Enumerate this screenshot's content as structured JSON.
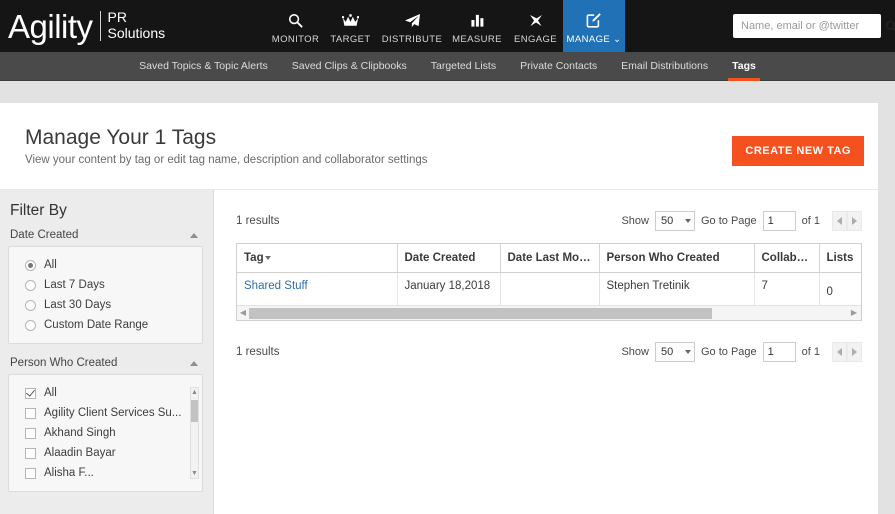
{
  "header": {
    "logo_main": "Agility",
    "logo_line1": "PR",
    "logo_line2": "Solutions",
    "nav": [
      {
        "label": "MONITOR",
        "icon": "search-icon",
        "active": false
      },
      {
        "label": "TARGET",
        "icon": "crown-icon",
        "active": false
      },
      {
        "label": "DISTRIBUTE",
        "icon": "paper-plane-icon",
        "active": false
      },
      {
        "label": "MEASURE",
        "icon": "bar-chart-icon",
        "active": false
      },
      {
        "label": "ENGAGE",
        "icon": "engage-icon",
        "active": false
      },
      {
        "label": "MANAGE",
        "icon": "edit-square-icon",
        "active": true
      }
    ],
    "manage_caret": "⌄",
    "search": {
      "placeholder": "Name, email or @twitter",
      "value": "",
      "icon": "search-icon"
    }
  },
  "subnav": {
    "items": [
      {
        "label": "Saved Topics & Topic Alerts",
        "active": false
      },
      {
        "label": "Saved Clips & Clipbooks",
        "active": false
      },
      {
        "label": "Targeted Lists",
        "active": false
      },
      {
        "label": "Private Contacts",
        "active": false
      },
      {
        "label": "Email Distributions",
        "active": false
      },
      {
        "label": "Tags",
        "active": true
      }
    ]
  },
  "page": {
    "title": "Manage Your 1 Tags",
    "subtitle": "View your content by tag or edit tag name, description and collaborator settings",
    "create_button": "CREATE NEW TAG",
    "accent_color": "#f4511e"
  },
  "sidebar": {
    "heading": "Filter By",
    "facets": [
      {
        "title": "Date Created",
        "collapse_icon": "chevron-up-icon",
        "type": "radio",
        "options": [
          {
            "label": "All",
            "checked": true
          },
          {
            "label": "Last 7 Days",
            "checked": false
          },
          {
            "label": "Last 30 Days",
            "checked": false
          },
          {
            "label": "Custom Date Range",
            "checked": false
          }
        ]
      },
      {
        "title": "Person Who Created",
        "collapse_icon": "chevron-up-icon",
        "type": "checkbox",
        "scrollable": true,
        "options": [
          {
            "label": "All",
            "checked": true
          },
          {
            "label": "Agility Client Services Su...",
            "checked": false
          },
          {
            "label": "Akhand Singh",
            "checked": false
          },
          {
            "label": "Alaadin Bayar",
            "checked": false
          },
          {
            "label": "Alisha F...",
            "checked": false
          }
        ]
      }
    ]
  },
  "main": {
    "results_label": "1 results",
    "pager": {
      "show_label": "Show",
      "page_size": "50",
      "goto_label": "Go to Page",
      "page_value": "1",
      "of_label": "of 1",
      "prev_icon": "triangle-left-icon",
      "next_icon": "triangle-right-icon"
    },
    "table": {
      "columns": [
        {
          "label": "Tag",
          "sorted": true,
          "sort_icon": "caret-down-icon"
        },
        {
          "label": "Date Created",
          "sorted": false
        },
        {
          "label": "Date Last Modified",
          "sorted": false
        },
        {
          "label": "Person Who Created",
          "sorted": false
        },
        {
          "label": "Collabora...",
          "sorted": false
        },
        {
          "label": "Lists",
          "sorted": false
        }
      ],
      "rows": [
        {
          "tag": "Shared Stuff",
          "date_created": "January 18,2018",
          "date_last_modified": "",
          "person_who_created": "Stephen Tretinik",
          "collaborators": "7",
          "lists": "0"
        }
      ]
    }
  }
}
